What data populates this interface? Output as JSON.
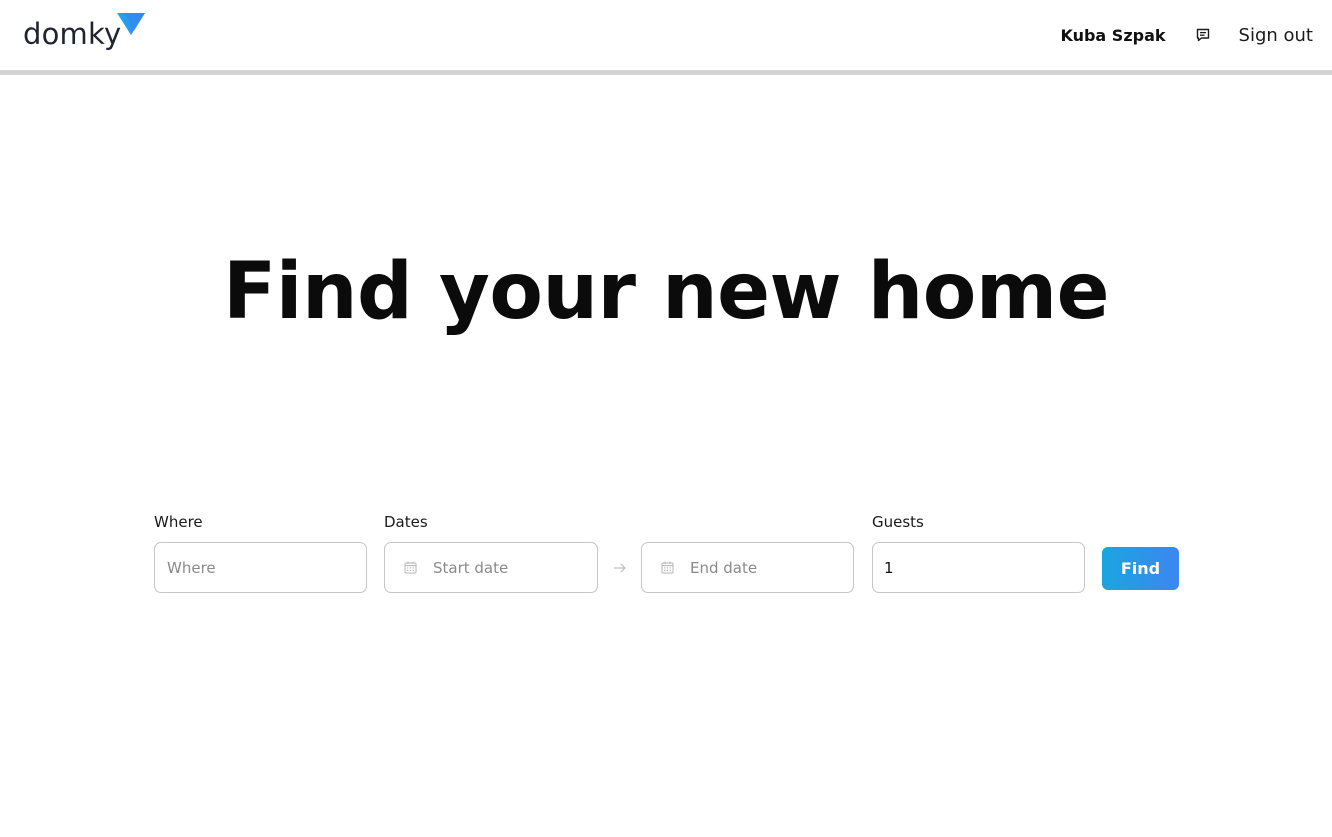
{
  "brand": {
    "name": "domky",
    "logo_icon": "triangle-down-icon",
    "accent_from": "#1fa9e8",
    "accent_to": "#3b82f6"
  },
  "header": {
    "user_name": "Kuba Szpak",
    "messages_icon": "chat-icon",
    "sign_out_label": "Sign out"
  },
  "hero": {
    "title": "Find your new home"
  },
  "search": {
    "where": {
      "label": "Where",
      "placeholder": "Where"
    },
    "dates": {
      "label": "Dates",
      "start_placeholder": "Start date",
      "end_placeholder": "End date",
      "calendar_icon": "calendar-icon",
      "separator_icon": "arrow-right-icon"
    },
    "guests": {
      "label": "Guests",
      "value": "1"
    },
    "find_label": "Find",
    "find_gradient": [
      "#19a6e0",
      "#3d86f0"
    ]
  }
}
